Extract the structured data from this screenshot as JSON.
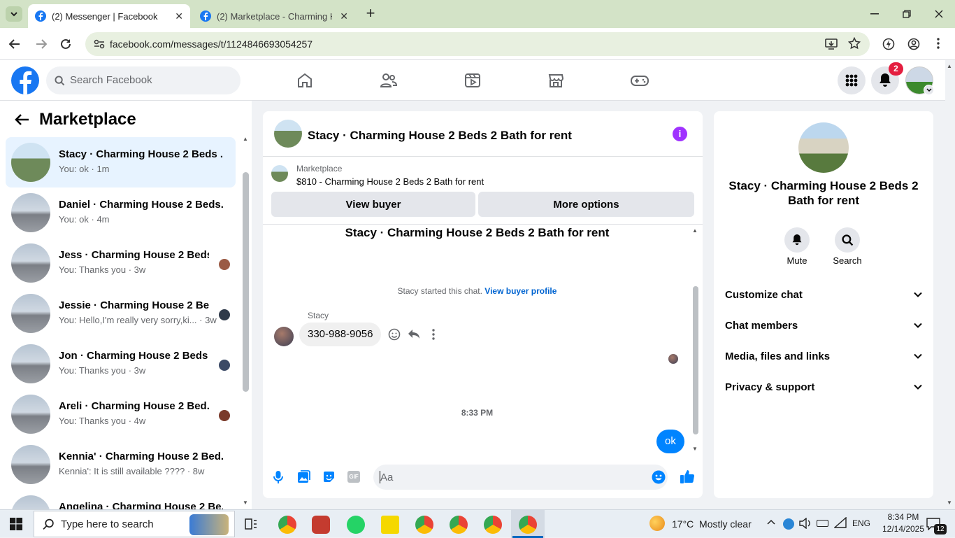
{
  "browser": {
    "tabs": [
      {
        "title": "(2) Messenger | Facebook"
      },
      {
        "title": "(2) Marketplace - Charming Ho"
      }
    ],
    "url": "facebook.com/messages/t/1124846693054257"
  },
  "fb_header": {
    "search_placeholder": "Search Facebook",
    "notification_count": "2"
  },
  "sidebar": {
    "title": "Marketplace",
    "conversations": [
      {
        "name": "Stacy · Charming House 2 Beds ...",
        "preview": "You: ok · 1m"
      },
      {
        "name": "Daniel · Charming House 2 Beds...",
        "preview": "You: ok · 4m"
      },
      {
        "name": "Jess · Charming House 2 Beds...",
        "preview": "You: Thanks you · 3w"
      },
      {
        "name": "Jessie · Charming House 2 Be...",
        "preview": "You: Hello,I'm really very sorry,ki... · 3w"
      },
      {
        "name": "Jon · Charming House 2 Beds ...",
        "preview": "You: Thanks you · 3w"
      },
      {
        "name": "Areli · Charming House 2 Bed...",
        "preview": "You: Thanks you · 4w"
      },
      {
        "name": "Kennia' · Charming House 2 Bed...",
        "preview": "Kennia': It is still available ???? · 8w"
      },
      {
        "name": "Angelina · Charming House 2 Be...",
        "preview": ""
      }
    ]
  },
  "chat": {
    "header_title": "Stacy · Charming House 2 Beds 2 Bath for rent",
    "listing_source": "Marketplace",
    "listing_price_title": "$810 - Charming House 2 Beds 2 Bath for rent",
    "view_buyer_label": "View buyer",
    "more_options_label": "More options",
    "thread_title": "Stacy · Charming House 2 Beds 2 Bath for rent",
    "started_text": "Stacy started this chat.",
    "view_profile_link": "View buyer profile",
    "sender_name": "Stacy",
    "incoming_message": "330-988-9056",
    "timestamp": "8:33 PM",
    "outgoing_message": "ok",
    "composer_placeholder": "Aa"
  },
  "details": {
    "title": "Stacy · Charming House 2 Beds 2 Bath for rent",
    "mute_label": "Mute",
    "search_label": "Search",
    "sections": [
      {
        "label": "Customize chat"
      },
      {
        "label": "Chat members"
      },
      {
        "label": "Media, files and links"
      },
      {
        "label": "Privacy & support"
      }
    ]
  },
  "taskbar": {
    "search_placeholder": "Type here to search",
    "weather": "17°C  Mostly clear",
    "language": "ENG",
    "time": "8:34 PM",
    "date": "12/14/2025",
    "notification_count": "12"
  },
  "colors": {
    "accent": "#1877f2",
    "messenger_blue": "#0084ff",
    "info_purple": "#a033ff",
    "notification_red": "#e41e3f"
  }
}
